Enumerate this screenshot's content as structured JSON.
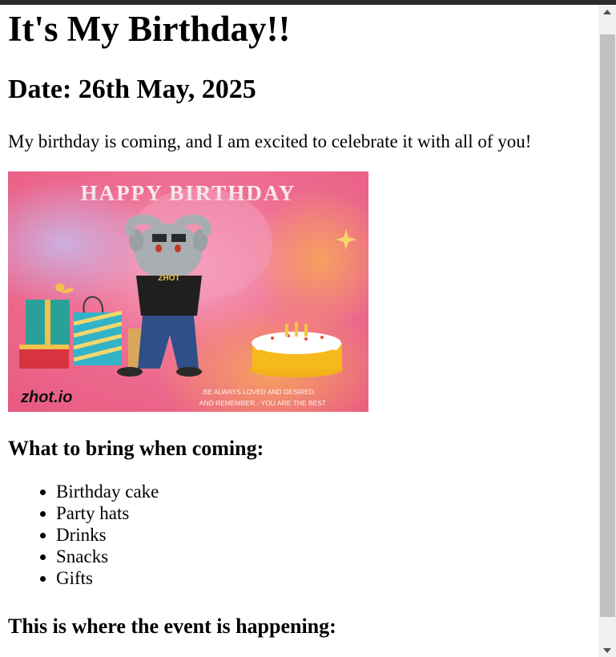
{
  "page": {
    "title": "It's My Birthday!!",
    "date": "Date: 26th May, 2025",
    "intro": "My birthday is coming, and I am excited to celebrate it with all of you!",
    "image": {
      "banner": "HAPPY BIRTHDAY",
      "shirt": "ZHOT",
      "logo": "zhot.io",
      "caption_line1": "BE ALWAYS LOVED AND DESIRED.",
      "caption_line2": "AND REMEMBER - YOU ARE THE BEST"
    },
    "bring_heading": "What to bring when coming:",
    "items": [
      "Birthday cake",
      "Party hats",
      "Drinks",
      "Snacks",
      "Gifts"
    ],
    "where_heading": "This is where the event is happening:"
  },
  "colors": {
    "top_bar": "#2b2b2b",
    "scroll_thumb": "#c1c1c1",
    "scroll_track": "#f1f1f1"
  },
  "icons": {
    "scroll_up": "triangle-up",
    "scroll_down": "triangle-down"
  }
}
